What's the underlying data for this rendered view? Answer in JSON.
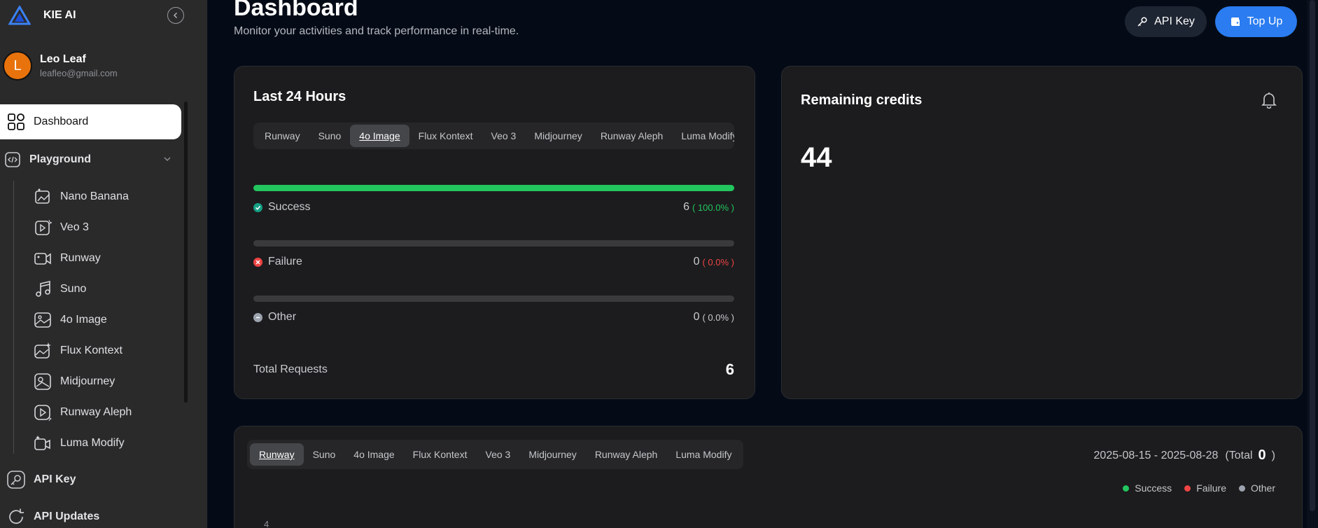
{
  "brand": {
    "name": "KIE AI"
  },
  "user": {
    "initial": "L",
    "name": "Leo Leaf",
    "email": "leafleo@gmail.com"
  },
  "sidebar": {
    "dashboard": "Dashboard",
    "playground": "Playground",
    "items": [
      {
        "label": "Nano Banana",
        "icon": "image-edit-icon"
      },
      {
        "label": "Veo 3",
        "icon": "video-sparkle-icon"
      },
      {
        "label": "Runway",
        "icon": "video-camera-icon"
      },
      {
        "label": "Suno",
        "icon": "music-note-icon"
      },
      {
        "label": "4o Image",
        "icon": "image-icon"
      },
      {
        "label": "Flux Kontext",
        "icon": "image-sparkle-icon"
      },
      {
        "label": "Midjourney",
        "icon": "image-frame-icon"
      },
      {
        "label": "Runway Aleph",
        "icon": "play-circle-icon"
      },
      {
        "label": "Luma Modify",
        "icon": "video-magic-icon"
      }
    ],
    "api_key": "API Key",
    "api_updates": "API Updates"
  },
  "header": {
    "title": "Dashboard",
    "subtitle": "Monitor your activities and track performance in real-time.",
    "api_key_button": "API Key",
    "top_up_button": "Top Up"
  },
  "last24": {
    "title": "Last 24 Hours",
    "tabs": [
      "Runway",
      "Suno",
      "4o Image",
      "Flux Kontext",
      "Veo 3",
      "Midjourney",
      "Runway Aleph",
      "Luma Modify"
    ],
    "active_tab": "4o Image",
    "stats": [
      {
        "name": "Success",
        "value": "6",
        "percent": "( 100.0% )",
        "fraction": 1.0,
        "color": "#22c55e"
      },
      {
        "name": "Failure",
        "value": "0",
        "percent": "( 0.0% )",
        "fraction": 0.0,
        "color": "#ef4444"
      },
      {
        "name": "Other",
        "value": "0",
        "percent": "( 0.0% )",
        "fraction": 0.0,
        "color": "#9ca3af"
      }
    ],
    "total_label": "Total Requests",
    "total_value": "6"
  },
  "credits": {
    "title": "Remaining credits",
    "value": "44"
  },
  "history": {
    "tabs": [
      "Runway",
      "Suno",
      "4o Image",
      "Flux Kontext",
      "Veo 3",
      "Midjourney",
      "Runway Aleph",
      "Luma Modify"
    ],
    "active_tab": "Runway",
    "range": "2025-08-15 - 2025-08-28",
    "total_prefix": "(Total",
    "total_value": "0",
    "total_suffix": ")",
    "legend": [
      {
        "name": "Success",
        "color": "#22c55e"
      },
      {
        "name": "Failure",
        "color": "#ef4444"
      },
      {
        "name": "Other",
        "color": "#9ca3af"
      }
    ],
    "y_tick_top": "4"
  }
}
